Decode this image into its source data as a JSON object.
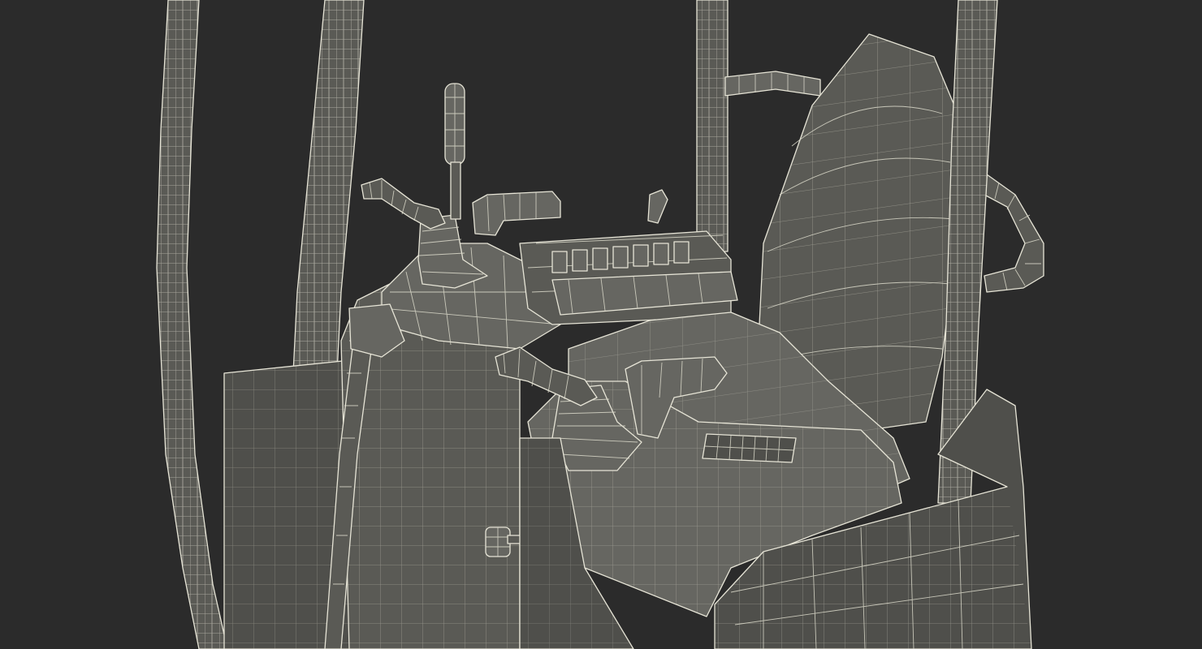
{
  "scene": {
    "subject": "",
    "colors": {
      "background": "#2b2b2b",
      "surface": "#5a5a55",
      "surface_dark": "#4f4f4b",
      "surface_light": "#666661",
      "wire": "#e6e4d6"
    }
  }
}
